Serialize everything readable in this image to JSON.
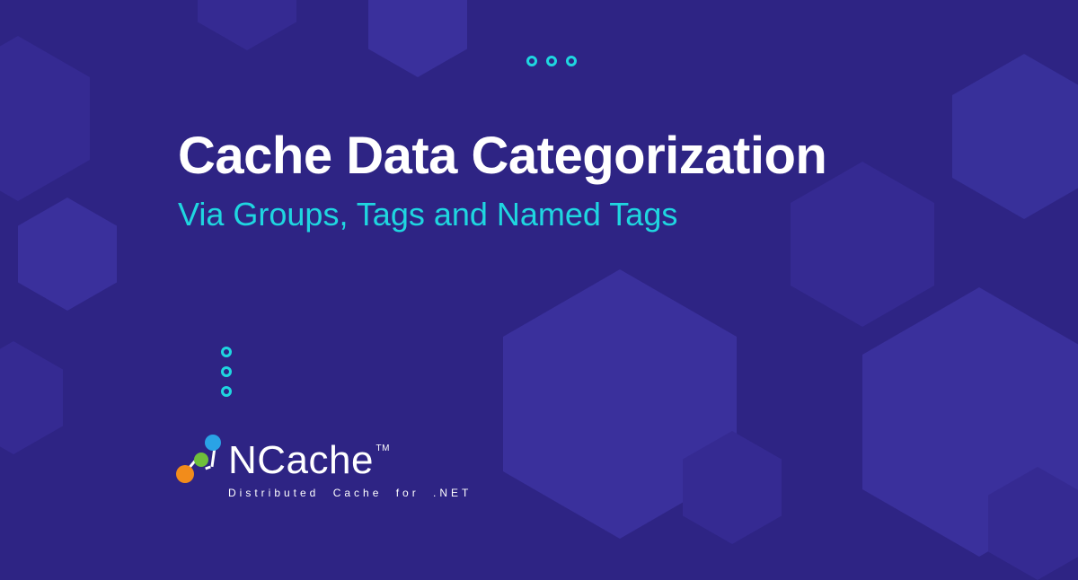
{
  "title": "Cache Data Categorization",
  "subtitle": "Via Groups, Tags and Named Tags",
  "logo": {
    "name": "NCache",
    "tm": "TM",
    "tagline": "Distributed Cache for .NET"
  }
}
